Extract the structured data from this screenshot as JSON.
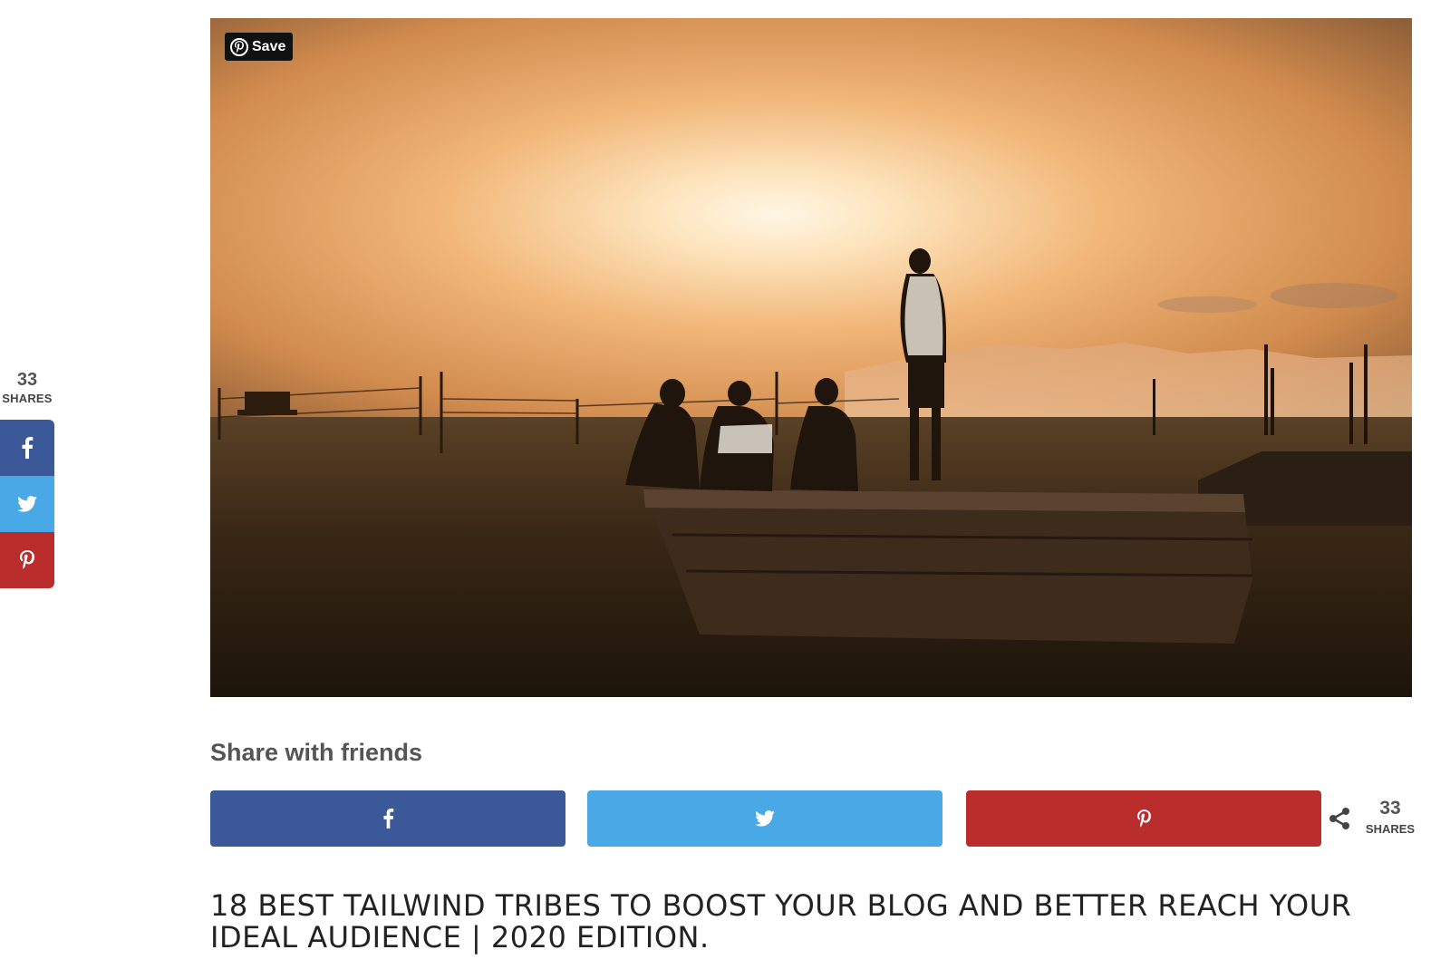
{
  "floating_bar": {
    "count": "33",
    "count_label": "SHARES",
    "buttons": [
      {
        "network": "facebook",
        "icon": "facebook-icon",
        "color": "#3b5998"
      },
      {
        "network": "twitter",
        "icon": "twitter-icon",
        "color": "#49a8e6"
      },
      {
        "network": "pinterest",
        "icon": "pinterest-icon",
        "color": "#b92d2d"
      }
    ]
  },
  "hero": {
    "save_button_label": "Save",
    "save_icon": "pinterest-icon"
  },
  "share": {
    "heading": "Share with friends",
    "buttons": [
      {
        "network": "facebook",
        "icon": "facebook-icon",
        "color": "#3b5998"
      },
      {
        "network": "twitter",
        "icon": "twitter-icon",
        "color": "#49a8e6"
      },
      {
        "network": "pinterest",
        "icon": "pinterest-icon",
        "color": "#b92d2d"
      }
    ],
    "total_icon": "share-icon",
    "total_count": "33",
    "total_label": "SHARES"
  },
  "post": {
    "title": "18 BEST TAILWIND TRIBES TO BOOST YOUR BLOG AND BETTER REACH YOUR IDEAL AUDIENCE | 2020 EDITION."
  }
}
